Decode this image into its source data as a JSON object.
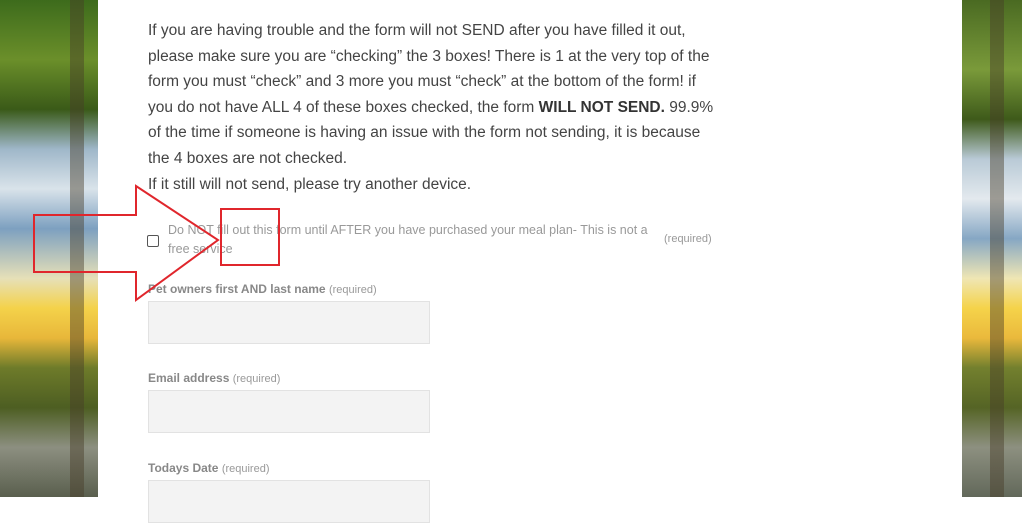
{
  "intro": {
    "line1": "If you are having trouble and the form will not SEND after you have filled it out, please make sure you are “checking” the 3 boxes!  There is 1 at the very top of the form you must “check” and 3 more you must “check” at the bottom of the form! if you do not have ALL 4 of these boxes checked, the form ",
    "bold": "WILL NOT SEND.",
    "line2": " 99.9% of the time if someone is having an issue with the form not sending, it is because the 4 boxes are not checked.",
    "line3": "If it still will not send, please try another device."
  },
  "consent_checkbox": {
    "label": "Do NOT fill out this form until AFTER you have purchased your meal plan- This is not a free service",
    "required": "(required)",
    "checked": false
  },
  "fields": [
    {
      "label": "Pet owners first AND last name",
      "required": "(required)",
      "value": ""
    },
    {
      "label": "Email address",
      "required": "(required)",
      "value": ""
    },
    {
      "label": "Todays Date",
      "required": "(required)",
      "value": ""
    }
  ],
  "colors": {
    "annotation": "#e0262c",
    "body_text": "#444444",
    "input_bg": "#f3f3f3"
  }
}
